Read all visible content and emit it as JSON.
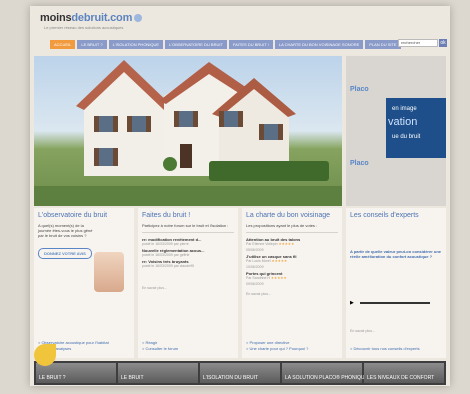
{
  "brand": {
    "name_prefix": "moins",
    "name_suffix": "debruit.com",
    "tagline": "Le premier réseau des solutions acoustiques"
  },
  "nav": [
    {
      "label": "ACCUEIL"
    },
    {
      "label": "LE BRUIT ?"
    },
    {
      "label": "L'ISOLATION PHONIQUE"
    },
    {
      "label": "L'OBSERVATOIRE DU BRUIT"
    },
    {
      "label": "FAITES DU BRUIT !"
    },
    {
      "label": "LA CHARTE DU BON VOISINAGE SONORE"
    },
    {
      "label": "PLAN DU SITE"
    }
  ],
  "search": {
    "value": "rechercher",
    "button": "ok"
  },
  "promo": {
    "top_text": "Placo",
    "screen_l1": "en image",
    "screen_l2": "vation",
    "screen_l3": "ue du bruit",
    "bottom_text": "Placo"
  },
  "col1": {
    "title": "L'observatoire du bruit",
    "text": "A quel(s) moment(s) de la journée êtes-vous le plus gêné par le bruit de vos voisins ?",
    "button": "DONNEZ VOTRE AVIS",
    "footer_link1": "> Observatoire acoustique pour l'habitat",
    "footer_link2": "> Lire les analyses"
  },
  "col2": {
    "title": "Faites du bruit !",
    "text": "Participez à notre forum sur le bruit et l'isolation :",
    "items": [
      {
        "title": "re: modification revêtement d...",
        "meta": "posté le 16/03/2009 par pierre"
      },
      {
        "title": "Nouvelle réglementation acous...",
        "meta": "posté le 16/03/2009 par geffrie"
      },
      {
        "title": "re: Voisins très bruyants",
        "meta": "posté le 16/03/2009 par claude95"
      }
    ],
    "more": "En savoir plus...",
    "footer_link1": "> Réagir",
    "footer_link2": "> Consulter le forum"
  },
  "col3": {
    "title": "La charte du bon voisinage",
    "text": "Les propositions ayant le plus de votes :",
    "items": [
      {
        "title": "Attention au bruit des talons",
        "meta": "Par Etienne Voilepin",
        "date": "05/06/2009",
        "stars": "★★★★★"
      },
      {
        "title": "J'utilise un casque sans fil",
        "meta": "Par Louis Morel",
        "date": "10/06/2009",
        "stars": "★★★★★"
      },
      {
        "title": "Portes qui grincent",
        "meta": "Par Sandrine H",
        "date": "09/06/2009",
        "stars": "★★★★★"
      }
    ],
    "more": "En savoir plus...",
    "footer_link1": "> Proposer une directive",
    "footer_link2": "> Une charte pour qui ? Pourquoi ?"
  },
  "col4": {
    "title": "Les conseils d'experts",
    "text": "A partir de quelle valeur peut-on considérer une réelle amélioration du confort acoustique ?",
    "more": "En savoir plus...",
    "footer_link1": "> Découvrir tous nos conseils d'experts"
  },
  "bottom": {
    "thumb1": "LE BRUIT ?",
    "thumb2": "LE BRUIT",
    "thumb3": "L'ISOLATION DU BRUIT",
    "thumb4": "LA SOLUTION PLACO® PHONIQUE",
    "thumb5": "LES NIVEAUX DE CONFORT"
  }
}
